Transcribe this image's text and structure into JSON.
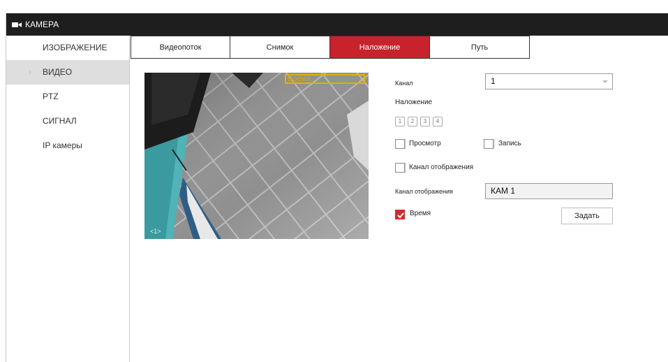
{
  "window": {
    "title": "КАМЕРА",
    "title_icon": "camera-icon"
  },
  "sidebar": {
    "items": [
      {
        "label": "ИЗОБРАЖЕНИЕ",
        "active": false
      },
      {
        "label": "ВИДЕО",
        "active": true,
        "marker": "›"
      },
      {
        "label": "PTZ",
        "active": false
      },
      {
        "label": "СИГНАЛ",
        "active": false
      },
      {
        "label": "IP камеры",
        "active": false
      }
    ]
  },
  "tabs": [
    {
      "label": "Видеопоток",
      "active": false
    },
    {
      "label": "Снимок",
      "active": false
    },
    {
      "label": "Наложение",
      "active": true
    },
    {
      "label": "Путь",
      "active": false
    }
  ],
  "preview": {
    "osd_time_label": "Время",
    "osd_channel_label": "<1>"
  },
  "form": {
    "channel_label": "Канал",
    "channel_value": "1",
    "overlay_label": "Наложение",
    "overlay_regions": [
      "1",
      "2",
      "3",
      "4"
    ],
    "preview_label": "Просмотр",
    "preview_checked": false,
    "record_label": "Запись",
    "record_checked": false,
    "channel_display_label": "Канал отображения",
    "channel_display_checked": false,
    "channel_name_label": "Канал отображения",
    "channel_name_value": "КАМ 1",
    "time_label": "Время",
    "time_checked": true,
    "set_button": "Задать"
  },
  "colors": {
    "accent": "#c8232c",
    "titlebar": "#1e1e1e",
    "active_side": "#dedede",
    "osd": "#e0b400"
  }
}
